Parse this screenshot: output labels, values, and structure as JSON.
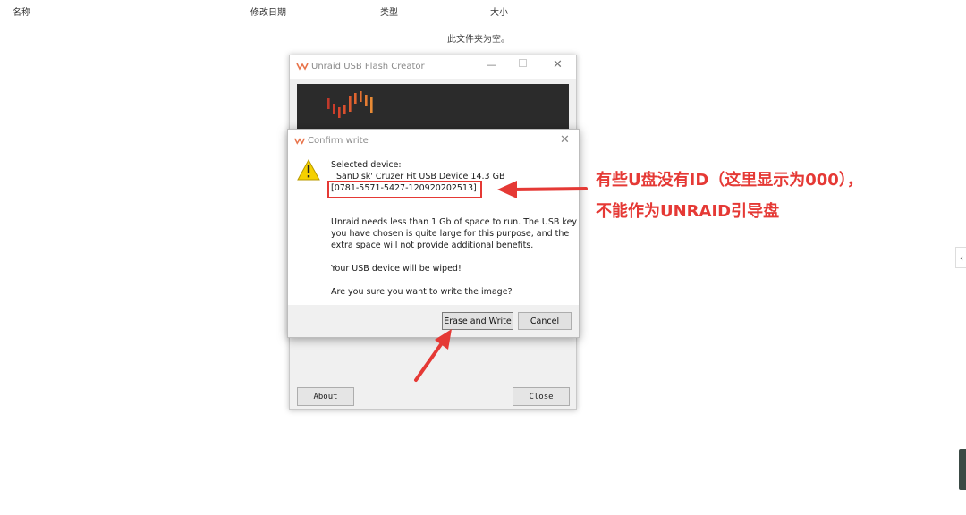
{
  "explorer": {
    "columns": [
      "名称",
      "修改日期",
      "类型",
      "大小"
    ],
    "empty_message": "此文件夹为空。"
  },
  "app_window": {
    "title": "Unraid USB Flash Creator",
    "about_label": "About",
    "close_label": "Close"
  },
  "dialog": {
    "title": "Confirm write",
    "selected_device_label": "Selected device:",
    "device_name": "SanDisk' Cruzer Fit USB Device 14.3 GB",
    "device_id": "[0781-5571-5427-120920202513]",
    "message_lines": [
      "Unraid needs less than 1 Gb of space to run. The USB key",
      "you have chosen is quite large for this purpose, and the",
      "extra space will not provide additional benefits."
    ],
    "wipe_warning": "Your USB device will be wiped!",
    "confirm_question": "Are you sure you want to write the image?",
    "erase_button": "Erase and Write",
    "cancel_button": "Cancel"
  },
  "annotation": {
    "line1": "有些U盘没有ID（这里显示为000），",
    "line2": "不能作为UNRAID引导盘",
    "color": "#e53935"
  }
}
